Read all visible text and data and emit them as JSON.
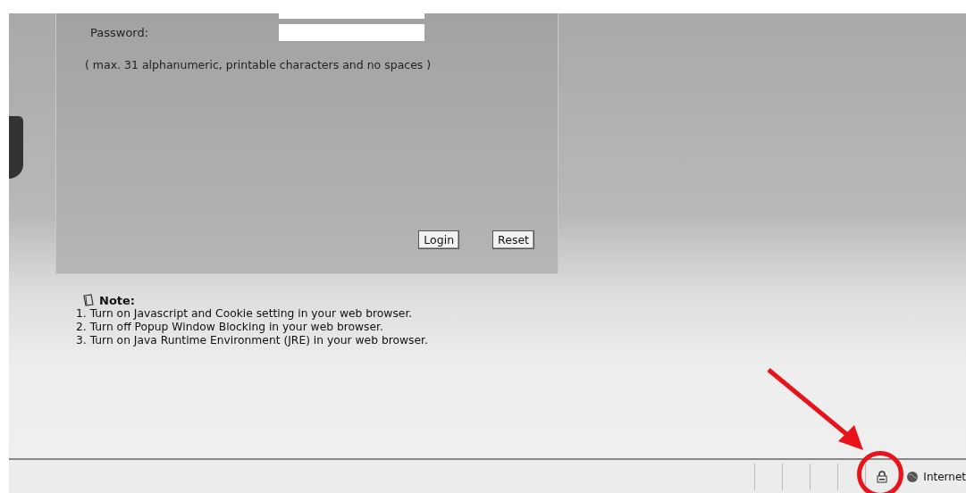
{
  "login_form": {
    "fields": [
      {
        "label": "Password:"
      }
    ],
    "hint": "( max. 31 alphanumeric, printable characters and no spaces )",
    "buttons": [
      "Login",
      "Reset"
    ]
  },
  "note": {
    "title": "Note:",
    "items": [
      "1. Turn on Javascript and Cookie setting in your web browser.",
      "2. Turn off Popup Window Blocking in your web browser.",
      "3. Turn on Java Runtime Environment (JRE) in your web browser."
    ]
  },
  "status_bar": {
    "zone": "Internet"
  }
}
